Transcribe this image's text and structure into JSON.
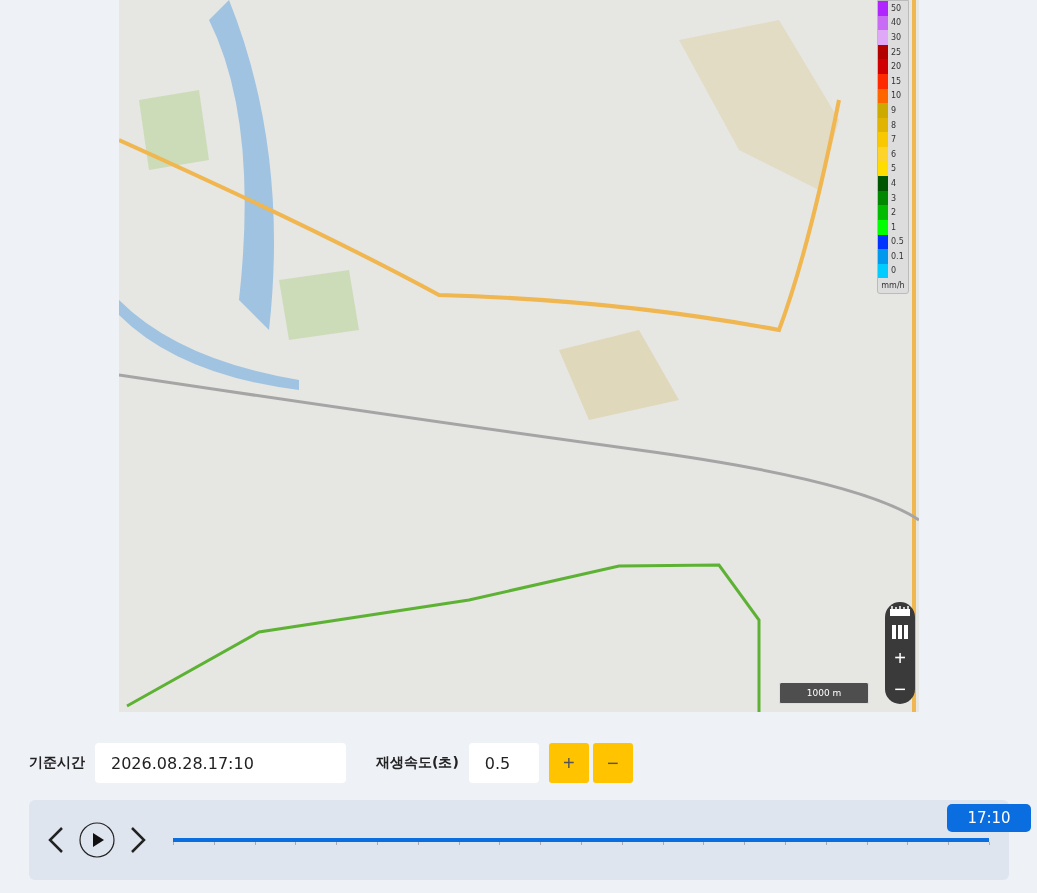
{
  "map": {
    "kind": "picture",
    "legend": {
      "unit": "mm/h",
      "items": [
        {
          "label": "50",
          "color": "#b026ff"
        },
        {
          "label": "40",
          "color": "#c86cf5"
        },
        {
          "label": "30",
          "color": "#dfa9f7"
        },
        {
          "label": "25",
          "color": "#b30000"
        },
        {
          "label": "20",
          "color": "#d10000"
        },
        {
          "label": "15",
          "color": "#ff2a00"
        },
        {
          "label": "10",
          "color": "#ff6600"
        },
        {
          "label": "9",
          "color": "#ccaa00"
        },
        {
          "label": "8",
          "color": "#e0b400"
        },
        {
          "label": "7",
          "color": "#f9c800"
        },
        {
          "label": "6",
          "color": "#ffd42a"
        },
        {
          "label": "5",
          "color": "#ffdd00"
        },
        {
          "label": "4",
          "color": "#005500"
        },
        {
          "label": "3",
          "color": "#008800"
        },
        {
          "label": "2",
          "color": "#00bb00"
        },
        {
          "label": "1",
          "color": "#00ff00"
        },
        {
          "label": "0.5",
          "color": "#0033ff"
        },
        {
          "label": "0.1",
          "color": "#0099ee"
        },
        {
          "label": "0",
          "color": "#00ccff"
        }
      ]
    },
    "scale": "1000 m",
    "zoom_buttons": [
      "+",
      "−"
    ]
  },
  "controls": {
    "base_time_label": "기준시간",
    "base_time_value": "2026.08.28.17:10",
    "speed_label": "재생속도(초)",
    "speed_value": "0.5",
    "buttons": [
      "+",
      "−"
    ]
  },
  "timeline": {
    "level": 1,
    "tooltip": "17:10"
  }
}
